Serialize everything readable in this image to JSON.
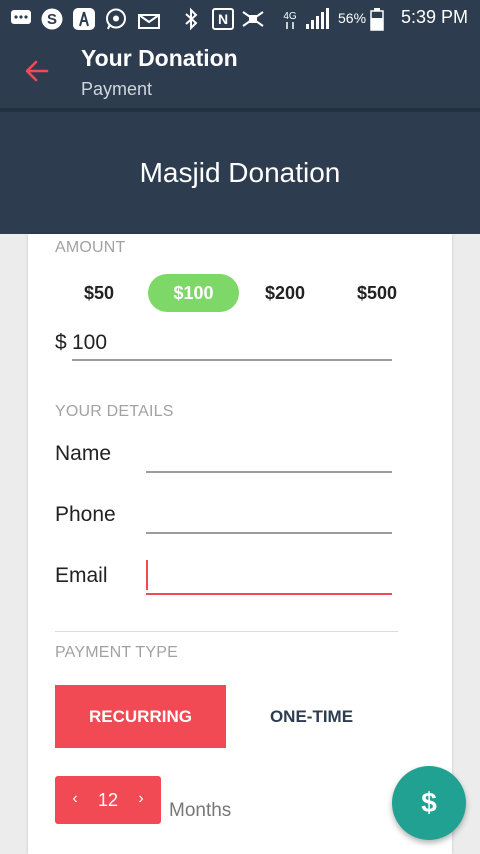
{
  "status_bar": {
    "battery": "56%",
    "time": "5:39 PM",
    "icons": [
      "messages-icon",
      "skype-icon",
      "acrobat-icon",
      "whatsapp-icon",
      "mail-icon",
      "bluetooth-icon",
      "nfc-icon",
      "mute-icon",
      "data-4g-icon",
      "signal-icon",
      "battery-icon"
    ]
  },
  "app_bar": {
    "title": "Your Donation",
    "subtitle": "Payment",
    "back_icon": "arrow-back-icon",
    "accent": "#f24a54"
  },
  "header": {
    "title": "Masjid Donation"
  },
  "amount": {
    "label": "AMOUNT",
    "options": [
      "$50",
      "$100",
      "$200",
      "$500"
    ],
    "selected": "$100",
    "currency": "$",
    "value": "100"
  },
  "details": {
    "label": "YOUR DETAILS",
    "name_label": "Name",
    "phone_label": "Phone",
    "email_label": "Email",
    "name_value": "",
    "phone_value": "",
    "email_value": ""
  },
  "payment": {
    "label": "PAYMENT TYPE",
    "recurring": "RECURRING",
    "one_time": "ONE-TIME",
    "selected": "RECURRING"
  },
  "recurrence": {
    "value": "12",
    "unit": "Months",
    "decrement": "‹",
    "increment": "›"
  },
  "fab": {
    "label": "$",
    "color": "#20a191"
  },
  "colors": {
    "primary": "#2d3c4e",
    "selected_amount": "#7ed867",
    "accent": "#f24a54"
  }
}
